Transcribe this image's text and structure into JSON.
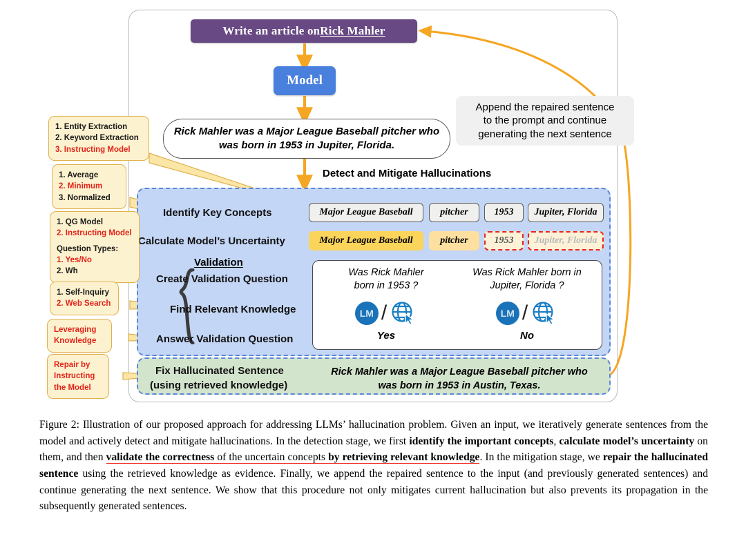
{
  "figure": {
    "prompt": {
      "prefix": "Write an article on ",
      "entity": "Rick Mahler"
    },
    "model_label": "Model",
    "generated_sentence_line1": "Rick Mahler was a Major League Baseball pitcher who",
    "generated_sentence_line2": "was born in 1953 in Jupiter, Florida.",
    "detect_label": "Detect and Mitigate Hallucinations",
    "append_note_line1": "Append the repaired sentence",
    "append_note_line2": "to the prompt and continue",
    "append_note_line3": "generating the next sentence",
    "rows": {
      "identify": "Identify Key Concepts",
      "uncertainty": "Calculate Model’s Uncertainty",
      "validation_title": "Validation",
      "create_question": "Create Validation Question",
      "find_knowledge": "Find Relevant Knowledge",
      "answer_question": "Answer Validation Question",
      "fix_line1": "Fix Hallucinated Sentence",
      "fix_line2": "(using retrieved knowledge)"
    },
    "concepts": [
      "Major League Baseball",
      "pitcher",
      "1953",
      "Jupiter, Florida"
    ],
    "uncertainty_chips": [
      {
        "text": "Major League Baseball",
        "style": "strong"
      },
      {
        "text": "pitcher",
        "style": "mid"
      },
      {
        "text": "1953",
        "style": "dashed"
      },
      {
        "text": "Jupiter, Florida",
        "style": "dashed-faded"
      }
    ],
    "validation_questions": [
      {
        "q_line1": "Was Rick Mahler",
        "q_line2": "born in 1953 ?",
        "lm_label": "LM",
        "answer": "Yes"
      },
      {
        "q_line1": "Was Rick Mahler born in",
        "q_line2": "Jupiter, Florida ?",
        "lm_label": "LM",
        "answer": "No"
      }
    ],
    "repaired_sentence_line1": "Rick Mahler was a Major League Baseball pitcher who",
    "repaired_sentence_line2": "was born in 1953 in Austin, Texas.",
    "callouts": [
      {
        "id": "concept-methods",
        "lines": [
          {
            "text": "1. Entity Extraction",
            "red": false
          },
          {
            "text": "2. Keyword Extraction",
            "red": false
          },
          {
            "text": "3. Instructing Model",
            "red": true
          }
        ]
      },
      {
        "id": "uncertainty-methods",
        "lines": [
          {
            "text": "1. Average",
            "red": false
          },
          {
            "text": "2. Minimum",
            "red": true
          },
          {
            "text": "3. Normalized",
            "red": false
          }
        ]
      },
      {
        "id": "question-methods",
        "lines": [
          {
            "text": "1. QG Model",
            "red": false
          },
          {
            "text": "2. Instructing Model",
            "red": true
          },
          {
            "text": "",
            "red": false
          },
          {
            "text": "Question Types:",
            "red": false
          },
          {
            "text": "1. Yes/No",
            "red": true
          },
          {
            "text": "2. Wh",
            "red": false
          }
        ]
      },
      {
        "id": "knowledge-methods",
        "lines": [
          {
            "text": "1. Self-Inquiry",
            "red": false
          },
          {
            "text": "2. Web Search",
            "red": true
          }
        ]
      },
      {
        "id": "answer-method",
        "lines": [
          {
            "text": "Leveraging",
            "red": true
          },
          {
            "text": "Knowledge",
            "red": true
          }
        ]
      },
      {
        "id": "repair-method",
        "lines": [
          {
            "text": "Repair by",
            "red": true
          },
          {
            "text": "Instructing",
            "red": true
          },
          {
            "text": "the Model",
            "red": true
          }
        ]
      }
    ]
  },
  "caption": {
    "segments": [
      {
        "text": "Figure 2: Illustration of our proposed approach for addressing LLMs’ hallucination problem. Given an input, we iteratively generate sentences from the model and actively detect and mitigate hallucinations.  In the detection stage, we first ",
        "bold": false,
        "underline": false
      },
      {
        "text": "identify the important concepts",
        "bold": true,
        "underline": true
      },
      {
        "text": ", ",
        "bold": false,
        "underline": true
      },
      {
        "text": "calculate model’s uncertainty",
        "bold": true,
        "underline": true
      },
      {
        "text": " on them, and then ",
        "bold": false,
        "underline": true
      },
      {
        "text": "validate the correctness",
        "bold": true,
        "underline": true
      },
      {
        "text": " of the uncertain concepts ",
        "bold": false,
        "underline": true
      },
      {
        "text": "by retrieving relevant knowledge",
        "bold": true,
        "underline": true
      },
      {
        "text": ". In the mitigation stage, we ",
        "bold": false,
        "underline": false
      },
      {
        "text": "repair the hallucinated sentence",
        "bold": true,
        "underline": false
      },
      {
        "text": " using the retrieved knowledge as evidence. Finally, we append the repaired sentence to the input (and previously generated sentences) and continue generating the next sentence. We show that this procedure not only mitigates current hallucination but also prevents its propagation in the subsequently generated sentences.",
        "bold": false,
        "underline": false
      }
    ]
  },
  "colors": {
    "prompt_bg": "#684983",
    "model_bg": "#4a80dd",
    "panel_bg": "#c4d6f5",
    "panel_border": "#5b86d6",
    "green_bg": "#d3e4cd",
    "arrow": "#f5a623",
    "callout_bg": "#fdf2cf",
    "callout_border": "#e0b14c",
    "red": "#e2231a",
    "chip_strong": "#fbd45c",
    "chip_mid": "#fde0a0",
    "lm_badge": "#1a72b8"
  }
}
